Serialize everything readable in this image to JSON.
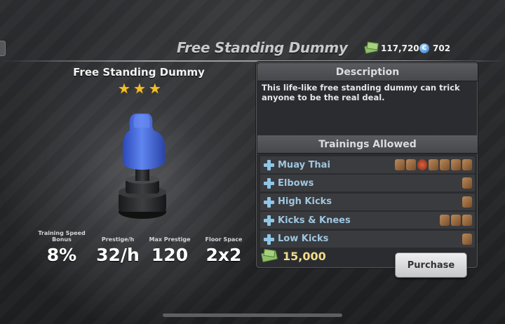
{
  "header": {
    "title": "Free Standing Dummy",
    "cash": "117,720",
    "coins": "702",
    "coin_symbol": "C"
  },
  "item": {
    "name": "Free Standing Dummy",
    "star_rating": 3,
    "max_stars": 3
  },
  "stats": [
    {
      "label": "Training Speed Bonus",
      "value": "8%"
    },
    {
      "label": "Prestige/h",
      "value": "32/h"
    },
    {
      "label": "Max Prestige",
      "value": "120"
    },
    {
      "label": "Floor Space",
      "value": "2x2"
    }
  ],
  "description": {
    "header": "Description",
    "text": "This life-like free standing dummy can trick anyone to be the real deal."
  },
  "trainings": {
    "header": "Trainings Allowed",
    "items": [
      {
        "label": "Muay Thai",
        "icon_count": 7
      },
      {
        "label": "Elbows",
        "icon_count": 1
      },
      {
        "label": "High Kicks",
        "icon_count": 1
      },
      {
        "label": "Kicks & Knees",
        "icon_count": 3
      },
      {
        "label": "Low Kicks",
        "icon_count": 1
      }
    ]
  },
  "purchase": {
    "price": "15,000",
    "button_label": "Purchase"
  },
  "icons": {
    "cash": "cash-bundle-icon",
    "coin": "coin-icon",
    "star": "star-icon",
    "plus": "plus-icon"
  },
  "colors": {
    "accent_blue": "#9ec6e0",
    "price_gold": "#f0dc8a",
    "star_gold": "#f2bf2b",
    "dummy_blue": "#3f66d8"
  }
}
